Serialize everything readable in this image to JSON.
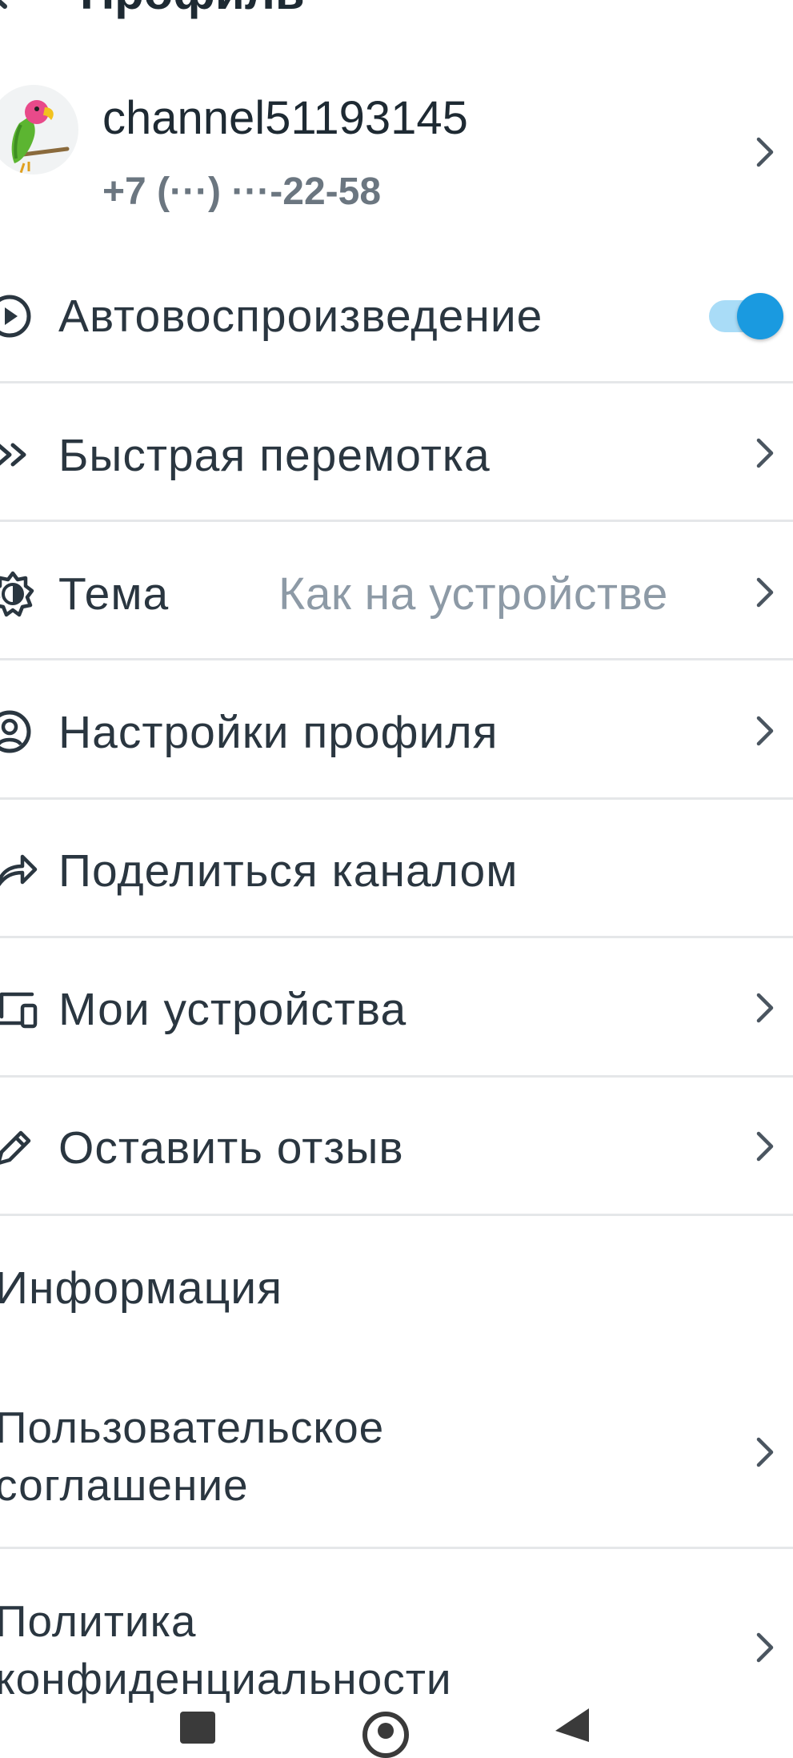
{
  "header": {
    "title": "Профиль"
  },
  "profile": {
    "username": "channel51193145",
    "phone": "+7 (···) ···-22-58"
  },
  "settings": {
    "autoplay_label": "Автовоспроизведение",
    "autoplay_enabled": true,
    "fast_forward_label": "Быстрая перемотка",
    "theme_label": "Тема",
    "theme_value": "Как на устройстве",
    "profile_settings_label": "Настройки профиля",
    "share_channel_label": "Поделиться каналом",
    "my_devices_label": "Мои устройства",
    "feedback_label": "Оставить отзыв"
  },
  "info": {
    "section_title": "Информация",
    "user_agreement_line1": "Пользовательское",
    "user_agreement_line2": "соглашение",
    "privacy_policy_line1": "Политика",
    "privacy_policy_line2": "конфиденциальности"
  },
  "colors": {
    "accent": "#1a9ae0",
    "accent_light": "#a9dcf7",
    "text": "#2a3640",
    "muted": "#8d9aa6",
    "divider": "#e5e7e9"
  },
  "icons": [
    "back-arrow-icon",
    "parrot-avatar",
    "chevron-right-icon",
    "play-circle-icon",
    "fast-forward-icon",
    "theme-gear-icon",
    "user-circle-icon",
    "share-icon",
    "devices-icon",
    "pencil-icon"
  ]
}
